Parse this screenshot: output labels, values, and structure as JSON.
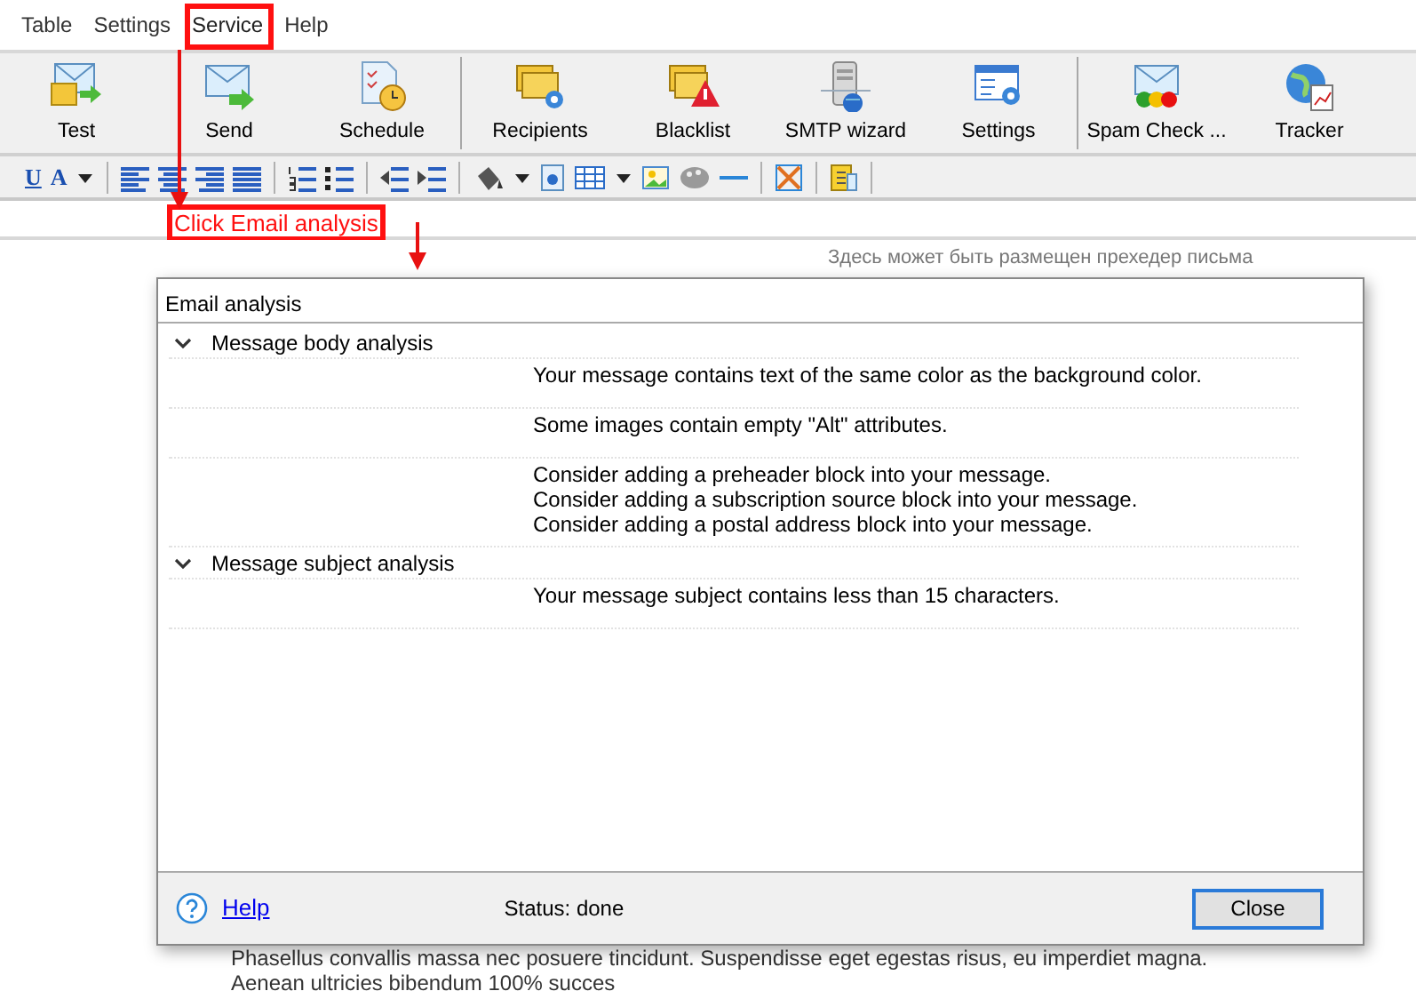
{
  "menu": [
    {
      "label": "Table",
      "highlighted": false
    },
    {
      "label": "Settings",
      "highlighted": false
    },
    {
      "label": "Service",
      "highlighted": true
    },
    {
      "label": "Help",
      "highlighted": false
    }
  ],
  "toolbar": {
    "groups": [
      {
        "buttons": [
          {
            "label": "Test"
          },
          {
            "label": "Send"
          },
          {
            "label": "Schedule"
          }
        ]
      },
      {
        "buttons": [
          {
            "label": "Recipients"
          },
          {
            "label": "Blacklist"
          },
          {
            "label": "SMTP wizard"
          },
          {
            "label": "Settings"
          }
        ]
      },
      {
        "buttons": [
          {
            "label": "Spam Check ..."
          },
          {
            "label": "Tracker"
          }
        ]
      }
    ]
  },
  "format_toolbar": {
    "underline_glyph": "U",
    "font_color_glyph": "A"
  },
  "annotation": {
    "text": "Click Email analysis"
  },
  "editor": {
    "preheader": "Здесь может быть размещен прехедер письма",
    "paragraph_lines": [
      "Phasellus convallis massa nec posuere tincidunt. Suspendisse eget egestas risus, eu imperdiet magna.",
      "Aenean ultricies bibendum 100% succes"
    ]
  },
  "dialog": {
    "title": "Email analysis",
    "groups": [
      {
        "label": "Message body analysis",
        "expanded": true,
        "messages": [
          {
            "lines": [
              "Your message contains text of the same color as the background color."
            ]
          },
          {
            "lines": [
              "Some images contain empty \"Alt\" attributes."
            ]
          },
          {
            "lines": [
              "Consider adding a preheader block into your message.",
              "Consider adding a subscription source block into your message.",
              "Consider adding a postal address block into your message."
            ]
          }
        ]
      },
      {
        "label": "Message subject analysis",
        "expanded": true,
        "messages": [
          {
            "lines": [
              "Your message subject contains less than 15 characters."
            ]
          }
        ]
      }
    ],
    "help_link": "Help",
    "status": "Status: done",
    "close_button": "Close"
  }
}
